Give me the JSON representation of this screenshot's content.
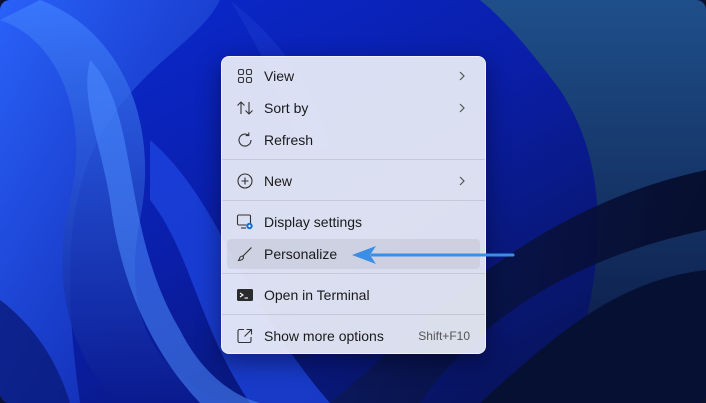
{
  "context_menu": {
    "items": [
      {
        "label": "View",
        "icon": "grid-view-icon",
        "submenu": true
      },
      {
        "label": "Sort by",
        "icon": "sort-icon",
        "submenu": true
      },
      {
        "label": "Refresh",
        "icon": "refresh-icon",
        "submenu": false
      },
      {
        "label": "New",
        "icon": "plus-circle-icon",
        "submenu": true
      },
      {
        "label": "Display settings",
        "icon": "display-settings-icon",
        "submenu": false
      },
      {
        "label": "Personalize",
        "icon": "brush-icon",
        "submenu": false
      },
      {
        "label": "Open in Terminal",
        "icon": "terminal-icon",
        "submenu": false
      },
      {
        "label": "Show more options",
        "icon": "share-icon",
        "submenu": false,
        "shortcut": "Shift+F10"
      }
    ]
  },
  "colors": {
    "accent_arrow": "#3a8ee6",
    "wallpaper_base": "#0b1f8a",
    "wallpaper_dark": "#061033"
  }
}
